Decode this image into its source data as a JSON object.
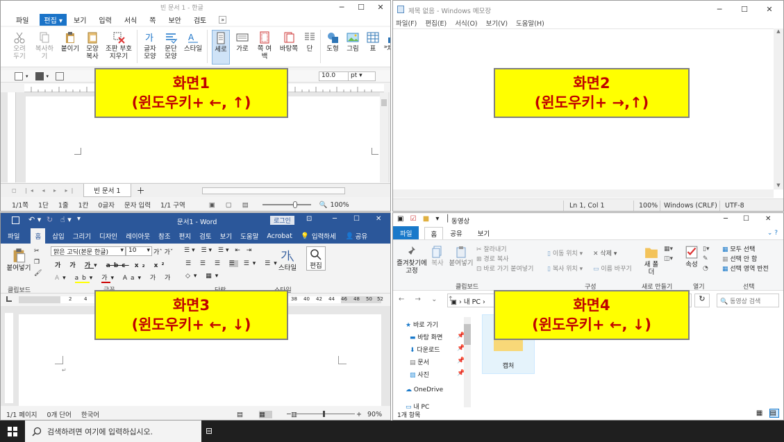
{
  "hwp": {
    "title": "빈 문서 1 - 한글",
    "menu": [
      "파일",
      "편집",
      "보기",
      "입력",
      "서식",
      "쪽",
      "보안",
      "검토"
    ],
    "menu_active": "편집",
    "ribbon": [
      "오려두기",
      "복사하기",
      "붙이기",
      "모양복사",
      "조판 부호 지우기",
      "글자 모양",
      "문단 모양",
      "스타일",
      "세로",
      "가로",
      "쪽 여백",
      "바탕쪽",
      "단",
      "도형",
      "그림",
      "표",
      "차트"
    ],
    "font_size": "10.0",
    "font_unit": "pt",
    "doc_tab": "빈 문서 1",
    "status": [
      "1/1쪽",
      "1단",
      "1줄",
      "1칸",
      "0글자",
      "문자 입력",
      "1/1 구역"
    ],
    "zoom": "100%"
  },
  "notepad": {
    "title": "제목 없음 - Windows 메모장",
    "menu": [
      "파일(F)",
      "편집(E)",
      "서식(O)",
      "보기(V)",
      "도움말(H)"
    ],
    "status": [
      "Ln 1, Col 1",
      "100%",
      "Windows (CRLF)",
      "UTF-8"
    ]
  },
  "word": {
    "title": "문서1 - Word",
    "login": "로그인",
    "tabs": [
      "파일",
      "홈",
      "삽입",
      "그리기",
      "디자인",
      "레이아웃",
      "참조",
      "편지",
      "검토",
      "보기",
      "도움말",
      "Acrobat"
    ],
    "tab_active": "홈",
    "tell": "입력하세",
    "share": "공유",
    "font": "맑은 고딕(본문 한글)",
    "size": "10",
    "groups": [
      "클립보드",
      "글꼴",
      "단락",
      "스타일"
    ],
    "paste": "붙여넣기",
    "style": "스타일",
    "edit": "편집",
    "ruler_nums": [
      "2",
      "4",
      "38",
      "40",
      "42",
      "44",
      "46",
      "48",
      "50",
      "52"
    ],
    "status": [
      "1/1 페이지",
      "0개 단어",
      "한국어"
    ],
    "zoom": "90%"
  },
  "explorer": {
    "title": "동영상",
    "tabs": [
      "파일",
      "홈",
      "공유",
      "보기"
    ],
    "ribbon": {
      "pin": "즐겨찾기에 고정",
      "copy": "복사",
      "paste": "붙여넣기",
      "cut": "잘라내기",
      "copy_path": "경로 복사",
      "paste_shortcut": "바로 가기 붙여넣기",
      "move_to": "이동 위치",
      "copy_to": "복사 위치",
      "delete": "삭제",
      "rename": "이름 바꾸기",
      "new_folder": "새 폴더",
      "properties": "속성",
      "select_all": "모두 선택",
      "select_none": "선택 안 함",
      "invert": "선택 영역 반전"
    },
    "groups": [
      "클립보드",
      "구성",
      "새로 만들기",
      "열기",
      "선택"
    ],
    "address": "내 PC",
    "search_placeholder": "동영상 검색",
    "nav": [
      "바로 가기",
      "바탕 화면",
      "다운로드",
      "문서",
      "사진",
      "OneDrive",
      "내 PC"
    ],
    "folder": "캡처",
    "status": "1개 항목"
  },
  "taskbar": {
    "search_placeholder": "검색하려면 여기에 입력하십시오."
  },
  "callouts": [
    {
      "line1": "화면1",
      "line2": "(윈도우키+ ←, ↑)"
    },
    {
      "line1": "화면2",
      "line2": "(윈도우키+ →,↑)"
    },
    {
      "line1": "화면3",
      "line2": "(윈도우키+ ←, ↓)"
    },
    {
      "line1": "화면4",
      "line2": "(윈도우키+ ←, ↓)"
    }
  ],
  "colors": {
    "word_blue": "#2b579a",
    "hwp_accent": "#1a73c8",
    "callout_bg": "#ffff00",
    "callout_text": "#c00000",
    "taskbar": "#1f1f1f"
  }
}
